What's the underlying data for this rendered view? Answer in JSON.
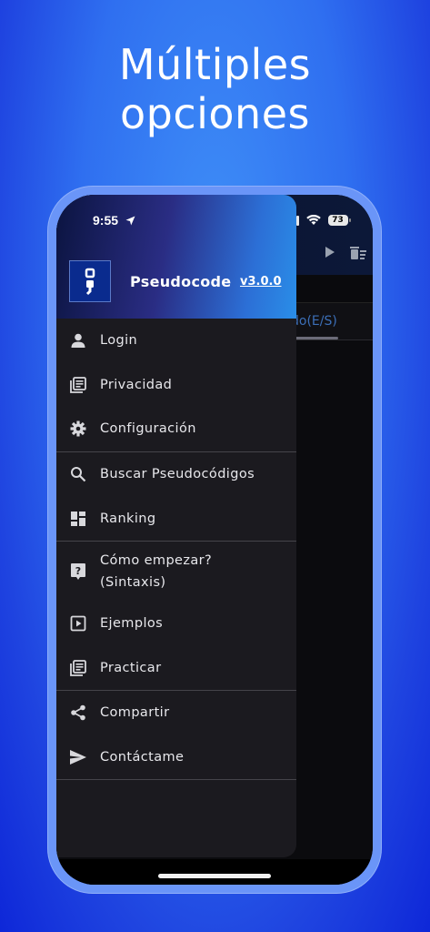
{
  "headline": {
    "line1": "Múltiples",
    "line2": "opciones"
  },
  "status_bar": {
    "time": "9:55",
    "battery": "73"
  },
  "background_app": {
    "tab_label": "do(E/S)"
  },
  "drawer": {
    "app_name": "Pseudocode",
    "version": "v3.0.0",
    "groups": [
      [
        {
          "icon": "person-icon",
          "label": "Login"
        },
        {
          "icon": "article-icon",
          "label": "Privacidad"
        },
        {
          "icon": "gear-icon",
          "label": "Configuración"
        }
      ],
      [
        {
          "icon": "search-icon",
          "label": "Buscar Pseudocódigos"
        },
        {
          "icon": "dashboard-icon",
          "label": "Ranking"
        }
      ],
      [
        {
          "icon": "help-icon",
          "label": "Cómo empezar?\n(Sintaxis)"
        },
        {
          "icon": "play-box-icon",
          "label": "Ejemplos"
        },
        {
          "icon": "article-icon",
          "label": "Practicar"
        }
      ],
      [
        {
          "icon": "share-icon",
          "label": "Compartir"
        },
        {
          "icon": "send-icon",
          "label": "Contáctame"
        }
      ]
    ]
  },
  "colors": {
    "background": "#2f6ff0",
    "drawer": "#1b1a1f",
    "accent": "#2c6fd6",
    "text": "#e8e8ec"
  }
}
